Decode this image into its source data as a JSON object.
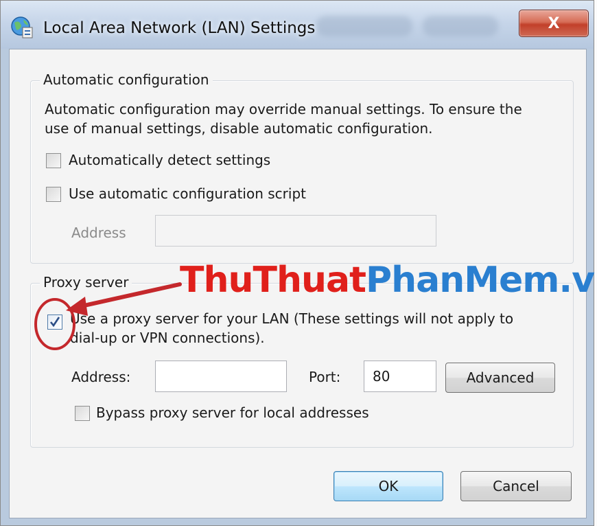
{
  "window": {
    "title": "Local Area Network (LAN) Settings",
    "close_glyph": "X"
  },
  "auto_config": {
    "legend": "Automatic configuration",
    "description_line1": "Automatic configuration may override manual settings.  To ensure the",
    "description_line2": "use of manual settings, disable automatic configuration.",
    "detect_label": "Automatically detect settings",
    "detect_checked": false,
    "script_label": "Use automatic configuration script",
    "script_checked": false,
    "address_label": "Address",
    "address_value": ""
  },
  "proxy": {
    "legend": "Proxy server",
    "use_proxy_line1": "Use a proxy server for your LAN (These settings will not apply to",
    "use_proxy_line2": "dial-up or VPN connections).",
    "use_proxy_checked": true,
    "address_label": "Address:",
    "address_value": "",
    "port_label": "Port:",
    "port_value": "80",
    "advanced_label": "Advanced",
    "bypass_label": "Bypass proxy server for local addresses",
    "bypass_checked": false
  },
  "buttons": {
    "ok_label": "OK",
    "cancel_label": "Cancel"
  },
  "watermark": {
    "part1": "ThuThuat",
    "part2": "PhanMem.vn"
  },
  "icons": {
    "app": "network-globe-icon",
    "close": "close-icon",
    "check": "checkmark-icon",
    "annotation_arrow": "red-arrow-icon",
    "annotation_circle": "red-circle-icon"
  },
  "colors": {
    "watermark_red": "#e0201b",
    "watermark_blue": "#2a7fd0",
    "annotation": "#c4282c"
  }
}
